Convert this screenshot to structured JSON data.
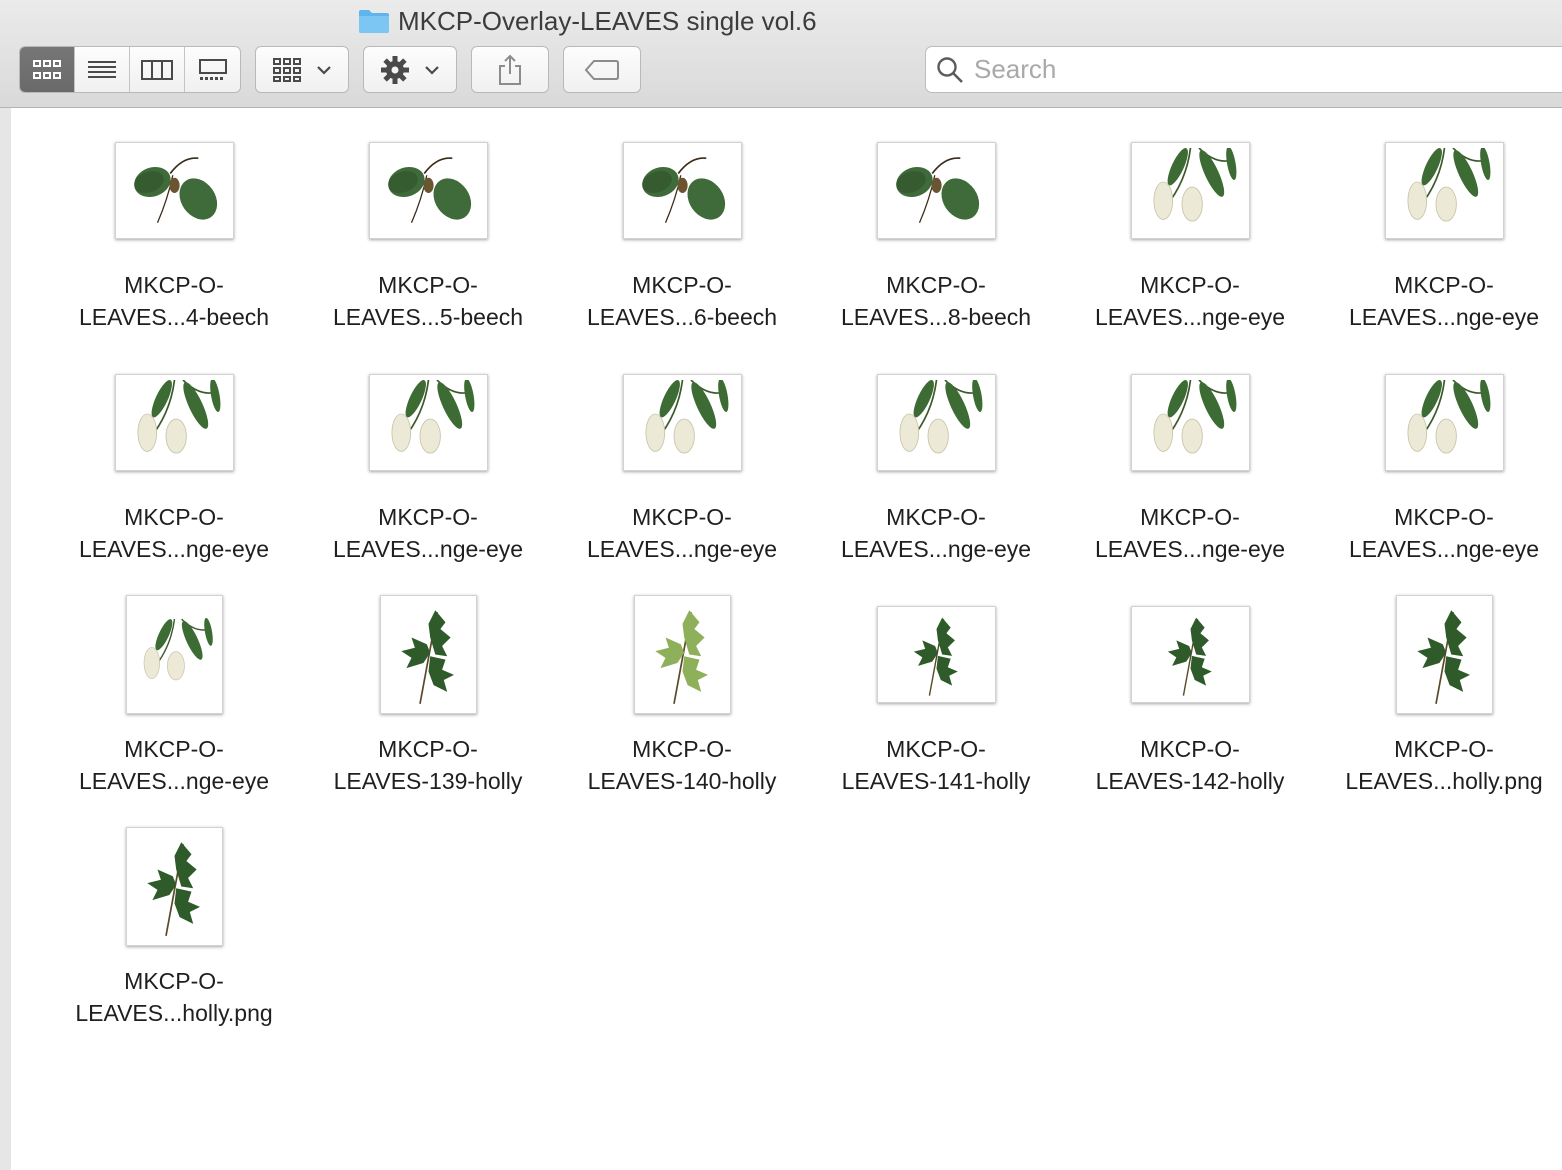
{
  "window": {
    "title": "MKCP-Overlay-LEAVES single vol.6",
    "folder_icon": "folder-icon"
  },
  "toolbar": {
    "view_modes": [
      {
        "name": "icon-view",
        "icon": "icon-grid-icon",
        "active": true
      },
      {
        "name": "list-view",
        "icon": "list-icon",
        "active": false
      },
      {
        "name": "column-view",
        "icon": "columns-icon",
        "active": false
      },
      {
        "name": "gallery-view",
        "icon": "gallery-icon",
        "active": false
      }
    ],
    "group_by_icon": "group-grid-icon",
    "action_icon": "gear-icon",
    "share_icon": "share-icon",
    "tag_icon": "tag-icon"
  },
  "search": {
    "placeholder": "Search",
    "value": ""
  },
  "files": [
    {
      "line1": "MKCP-O-",
      "line2": "LEAVES...4-beech",
      "kind": "beech",
      "orientation": "landscape"
    },
    {
      "line1": "MKCP-O-",
      "line2": "LEAVES...5-beech",
      "kind": "beech",
      "orientation": "landscape"
    },
    {
      "line1": "MKCP-O-",
      "line2": "LEAVES...6-beech",
      "kind": "beech",
      "orientation": "landscape"
    },
    {
      "line1": "MKCP-O-",
      "line2": "LEAVES...8-beech",
      "kind": "beech",
      "orientation": "landscape"
    },
    {
      "line1": "MKCP-O-",
      "line2": "LEAVES...nge-eye",
      "kind": "blossom",
      "orientation": "landscape"
    },
    {
      "line1": "MKCP-O-",
      "line2": "LEAVES...nge-eye",
      "kind": "blossom",
      "orientation": "landscape"
    },
    {
      "line1": "MKCP-O-",
      "line2": "LEAVES...nge-eye",
      "kind": "blossom",
      "orientation": "landscape"
    },
    {
      "line1": "MKCP-O-",
      "line2": "LEAVES...nge-eye",
      "kind": "blossom",
      "orientation": "landscape"
    },
    {
      "line1": "MKCP-O-",
      "line2": "LEAVES...nge-eye",
      "kind": "blossom",
      "orientation": "landscape"
    },
    {
      "line1": "MKCP-O-",
      "line2": "LEAVES...nge-eye",
      "kind": "blossom",
      "orientation": "landscape"
    },
    {
      "line1": "MKCP-O-",
      "line2": "LEAVES...nge-eye",
      "kind": "blossom",
      "orientation": "landscape"
    },
    {
      "line1": "MKCP-O-",
      "line2": "LEAVES...nge-eye",
      "kind": "blossom",
      "orientation": "landscape"
    },
    {
      "line1": "MKCP-O-",
      "line2": "LEAVES...nge-eye",
      "kind": "blossom",
      "orientation": "portrait"
    },
    {
      "line1": "MKCP-O-",
      "line2": "LEAVES-139-holly",
      "kind": "holly",
      "orientation": "portrait"
    },
    {
      "line1": "MKCP-O-",
      "line2": "LEAVES-140-holly",
      "kind": "holly-light",
      "orientation": "portrait"
    },
    {
      "line1": "MKCP-O-",
      "line2": "LEAVES-141-holly",
      "kind": "holly",
      "orientation": "landscape"
    },
    {
      "line1": "MKCP-O-",
      "line2": "LEAVES-142-holly",
      "kind": "holly",
      "orientation": "landscape"
    },
    {
      "line1": "MKCP-O-",
      "line2": "LEAVES...holly.png",
      "kind": "holly",
      "orientation": "portrait"
    },
    {
      "line1": "MKCP-O-",
      "line2": "LEAVES...holly.png",
      "kind": "holly",
      "orientation": "portrait"
    }
  ],
  "colors": {
    "beech_leaf": "#3f6a3a",
    "beech_dark": "#24401f",
    "blossom_leaf": "#3d6b34",
    "blossom_flower": "#ece9d6",
    "holly_leaf": "#2f5a2a",
    "holly_light": "#8fb05a",
    "folder": "#5fb4ec"
  }
}
